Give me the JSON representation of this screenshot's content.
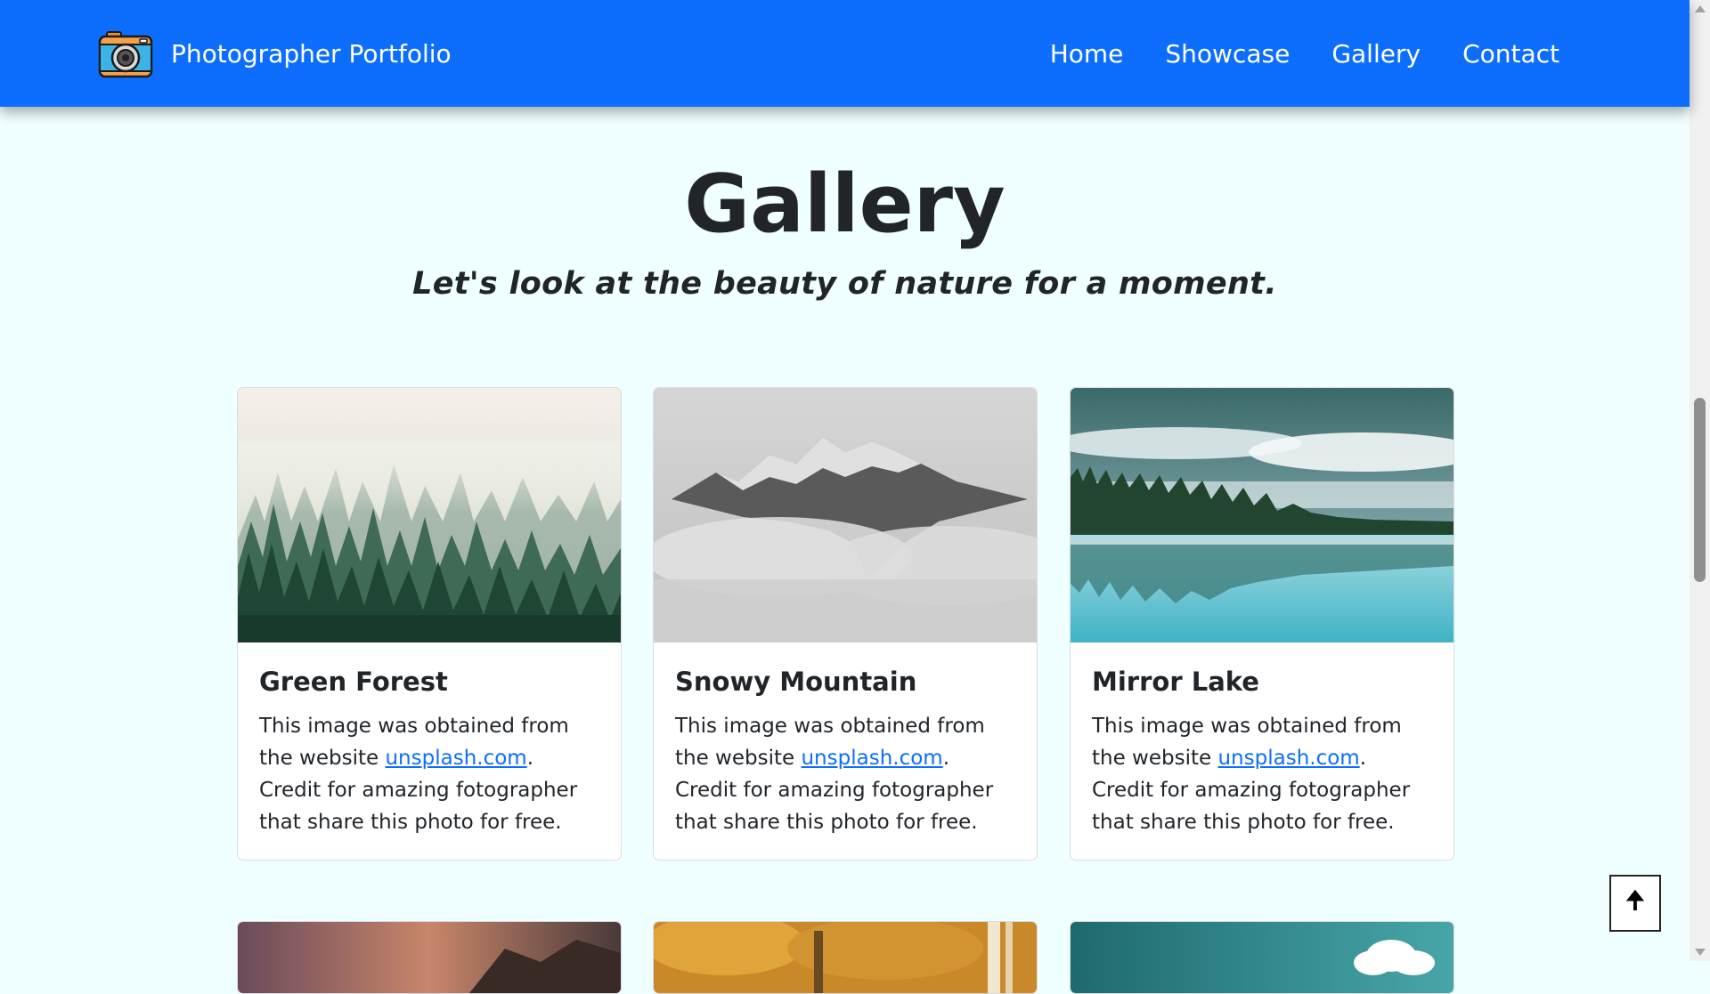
{
  "navbar": {
    "brand": "Photographer Portfolio",
    "logo_icon": "camera-icon",
    "links": [
      "Home",
      "Showcase",
      "Gallery",
      "Contact"
    ],
    "background": "#0d6efd"
  },
  "header": {
    "title": "Gallery",
    "subtitle": "Let's look at the beauty of nature for a moment."
  },
  "cards": [
    {
      "title": "Green Forest",
      "text_before": "This image was obtained from the website ",
      "link_text": "unsplash.com",
      "text_after": ". Credit for amazing fotographer that share this photo for free."
    },
    {
      "title": "Snowy Mountain",
      "text_before": "This image was obtained from the website ",
      "link_text": "unsplash.com",
      "text_after": ". Credit for amazing fotographer that share this photo for free."
    },
    {
      "title": "Mirror Lake",
      "text_before": "This image was obtained from the website ",
      "link_text": "unsplash.com",
      "text_after": ". Credit for amazing fotographer that share this photo for free."
    }
  ],
  "back_to_top": {
    "label": "🠉",
    "icon": "arrow-up-icon"
  },
  "colors": {
    "page_background": "#f0ffff",
    "link": "#0d6efd"
  }
}
